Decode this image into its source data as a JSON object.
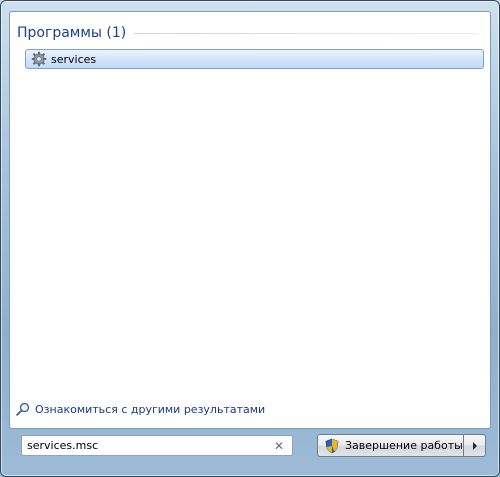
{
  "results": {
    "section_title": "Программы (1)",
    "items": [
      {
        "label": "services",
        "icon": "services-gear-icon"
      }
    ],
    "more_results_label": "Ознакомиться с другими результатами"
  },
  "search": {
    "value": "services.msc",
    "clear_icon": "close-icon"
  },
  "shutdown": {
    "label": "Завершение работы",
    "icon": "shield-icon",
    "arrow_icon": "chevron-right-icon"
  },
  "colors": {
    "section_title": "#1e3f8a",
    "selection": "#c2dbf8",
    "link": "#1c3a84"
  }
}
